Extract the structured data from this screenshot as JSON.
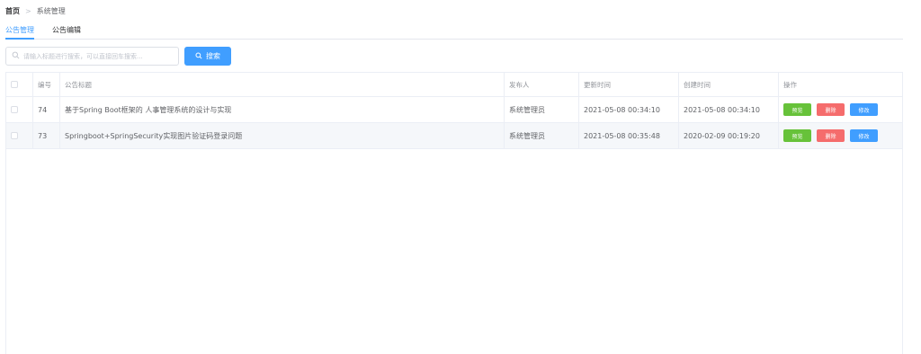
{
  "breadcrumb": {
    "home": "首页",
    "separator": ">",
    "current": "系统管理"
  },
  "tabs": [
    {
      "label": "公告管理",
      "active": true
    },
    {
      "label": "公告编辑",
      "active": false
    }
  ],
  "search": {
    "placeholder": "请输入标题进行搜索，可以直接回车搜索...",
    "value": "",
    "button_label": "搜索",
    "icon": "search-icon"
  },
  "table": {
    "headers": {
      "id": "编号",
      "title": "公告标题",
      "publisher": "发布人",
      "updated": "更新时间",
      "created": "创建时间",
      "ops": "操作"
    },
    "rows": [
      {
        "id": "74",
        "title": "基于Spring Boot框架的 人事管理系统的设计与实现",
        "publisher": "系统管理员",
        "updated": "2021-05-08 00:34:10",
        "created": "2021-05-08 00:34:10"
      },
      {
        "id": "73",
        "title": "Springboot+SpringSecurity实现图片验证码登录问题",
        "publisher": "系统管理员",
        "updated": "2021-05-08 00:35:48",
        "created": "2020-02-09 00:19:20"
      }
    ],
    "actions": {
      "preview": "预览",
      "delete": "删除",
      "edit": "修改"
    }
  },
  "colors": {
    "primary": "#409eff",
    "success": "#67c23a",
    "danger": "#f56c6c",
    "border": "#ebeef5",
    "stripe": "#f5f7fa"
  }
}
